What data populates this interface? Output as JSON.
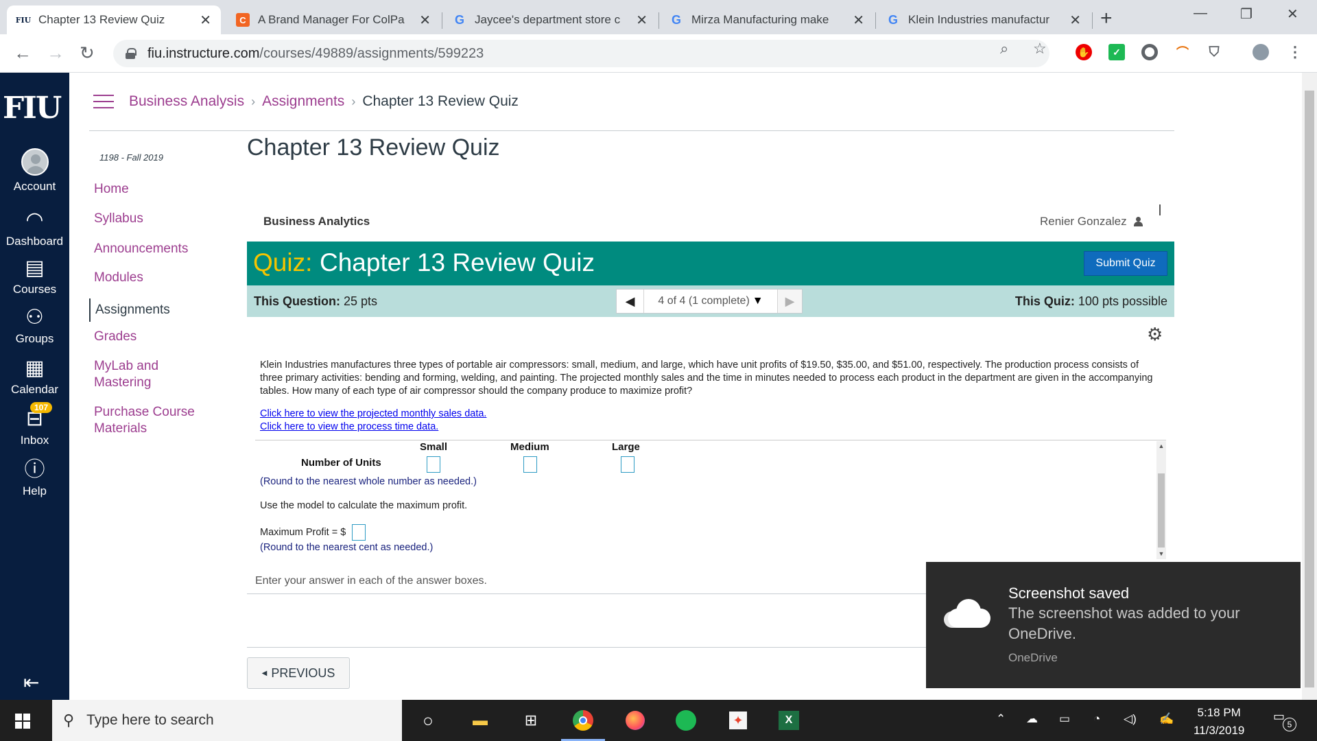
{
  "browser": {
    "tabs": [
      {
        "favicon": "FIU",
        "title": "Chapter 13 Review Quiz",
        "active": true
      },
      {
        "favicon": "C",
        "title": "A Brand Manager For ColPa"
      },
      {
        "favicon": "G",
        "title": "Jaycee's department store c"
      },
      {
        "favicon": "G",
        "title": "Mirza Manufacturing make"
      },
      {
        "favicon": "G",
        "title": "Klein Industries manufactur"
      }
    ],
    "new_tab": "+",
    "url_host": "fiu.instructure.com",
    "url_path": "/courses/49889/assignments/599223"
  },
  "global_nav": {
    "logo": "FIU",
    "items": [
      {
        "label": "Account",
        "icon": "account-avatar"
      },
      {
        "label": "Dashboard",
        "icon": "dashboard-icon"
      },
      {
        "label": "Courses",
        "icon": "courses-icon"
      },
      {
        "label": "Groups",
        "icon": "groups-icon"
      },
      {
        "label": "Calendar",
        "icon": "calendar-icon"
      },
      {
        "label": "Inbox",
        "icon": "inbox-icon",
        "badge": "107"
      },
      {
        "label": "Help",
        "icon": "help-icon"
      }
    ]
  },
  "breadcrumb": {
    "course": "Business Analysis",
    "section": "Assignments",
    "current": "Chapter 13 Review Quiz"
  },
  "course_nav": {
    "term": "1198 - Fall 2019",
    "items": [
      "Home",
      "Syllabus",
      "Announcements",
      "Modules",
      "Assignments",
      "Grades",
      "MyLab and Mastering",
      "Purchase Course Materials"
    ],
    "active": "Assignments"
  },
  "main": {
    "page_title": "Chapter 13 Review Quiz",
    "course_name": "Business Analytics",
    "user_name": "Renier Gonzalez",
    "quiz_label": "Quiz:",
    "quiz_title": "Chapter 13 Review Quiz",
    "submit_label": "Submit Quiz",
    "this_question_label": "This Question:",
    "this_question_value": "25 pts",
    "nav_status": "4 of 4 (1 complete)",
    "this_quiz_label": "This Quiz:",
    "this_quiz_value": "100 pts possible",
    "problem_text": "Klein Industries manufactures three types of portable air compressors: small, medium, and large, which have unit profits of $19.50, $35.00, and $51.00, respectively. The production process consists of three primary activities: bending and forming, welding, and painting. The projected monthly sales and the time in minutes needed to process each product in the department are given in the accompanying tables. How many of each type of air compressor should the company produce to maximize profit?",
    "link_sales": "Click here to view the projected monthly sales data.",
    "link_time": "Click here to view the process time data.",
    "col_small": "Small",
    "col_medium": "Medium",
    "col_large": "Large",
    "row_label": "Number of Units",
    "round_whole": "(Round to the nearest whole number as needed.)",
    "use_model": "Use the model to calculate the maximum profit.",
    "max_profit_label": "Maximum Profit = $",
    "round_cent": "(Round to the nearest cent as needed.)",
    "enter_answer": "Enter your answer in each of the answer boxes.",
    "previous_label": "PREVIOUS"
  },
  "toast": {
    "title": "Screenshot saved",
    "body": "The screenshot was added to your OneDrive.",
    "source": "OneDrive"
  },
  "taskbar": {
    "search_placeholder": "Type here to search",
    "time": "5:18 PM",
    "date": "11/3/2019",
    "notification_count": "5"
  },
  "colors": {
    "canvas_nav": "#081e3f",
    "quiz_banner": "#008b7f",
    "quiz_label": "#f5c400",
    "link": "#9c3d8f",
    "submit": "#0f6bbd"
  }
}
